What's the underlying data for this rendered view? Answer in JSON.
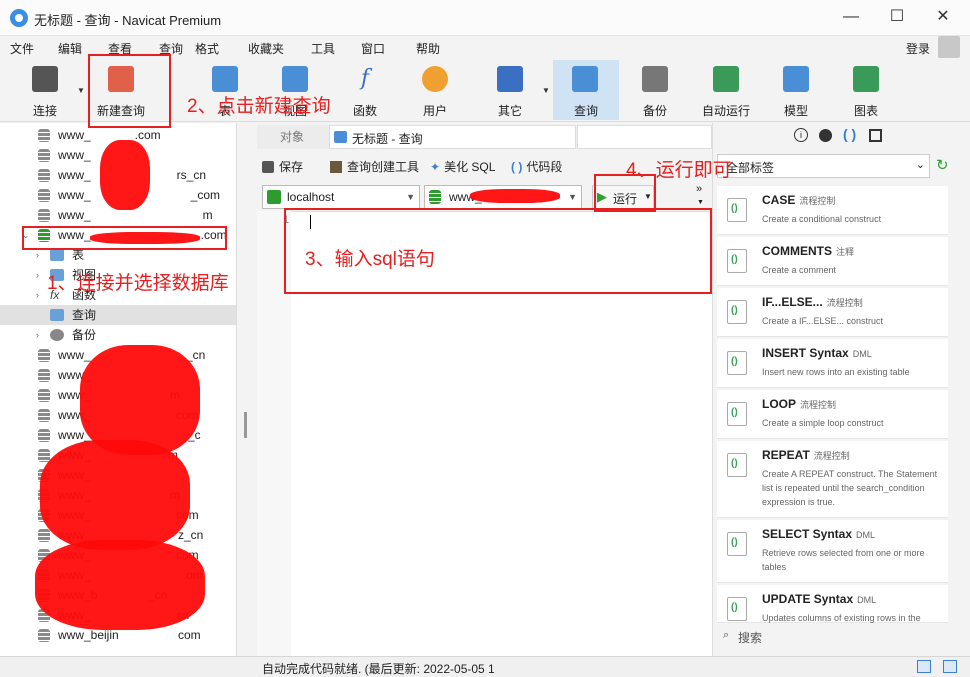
{
  "window": {
    "title": "无标题 - 查询 - Navicat Premium",
    "minimize": "—",
    "maximize": "☐",
    "close": "✕"
  },
  "menu": [
    "文件",
    "编辑",
    "查看",
    "查询",
    "格式",
    "收藏夹",
    "工具",
    "窗口",
    "帮助"
  ],
  "login": "登录",
  "toolbar": [
    {
      "label": "连接",
      "icon": "plug-icon",
      "color": "#555555"
    },
    {
      "label": "新建查询",
      "icon": "new-query-icon",
      "color": "#e0604a"
    },
    {
      "label": "表",
      "icon": "table-icon",
      "color": "#4a8fd6"
    },
    {
      "label": "视图",
      "icon": "view-icon",
      "color": "#4a8fd6"
    },
    {
      "label": "函数",
      "icon": "function-icon",
      "color": "#3a6fc2"
    },
    {
      "label": "用户",
      "icon": "user-icon",
      "color": "#f0a030"
    },
    {
      "label": "其它",
      "icon": "tools-icon",
      "color": "#3a6fc2"
    },
    {
      "label": "查询",
      "icon": "query-icon",
      "color": "#4a8fd6"
    },
    {
      "label": "备份",
      "icon": "backup-icon",
      "color": "#777777"
    },
    {
      "label": "自动运行",
      "icon": "auto-run-icon",
      "color": "#3a9a5a"
    },
    {
      "label": "模型",
      "icon": "model-icon",
      "color": "#4a8fd6"
    },
    {
      "label": "图表",
      "icon": "chart-icon",
      "color": "#3a9a5a"
    }
  ],
  "tree": {
    "rows": [
      {
        "label": "www_",
        "suffix": ".com"
      },
      {
        "label": "www_",
        "suffix": ""
      },
      {
        "label": "www_",
        "suffix": "rs_cn"
      },
      {
        "label": "www_",
        "suffix": "_com"
      },
      {
        "label": "www_",
        "suffix": "m"
      },
      {
        "label": "www_",
        "suffix": ".com"
      }
    ],
    "children": [
      "表",
      "视图",
      "函数",
      "查询",
      "备份"
    ],
    "more_rows": [
      {
        "label": "www_",
        "suffix": "_cn"
      },
      {
        "label": "www_",
        "suffix": ""
      },
      {
        "label": "www_",
        "suffix": "m"
      },
      {
        "label": "www_",
        "suffix": "com"
      },
      {
        "label": "www_",
        "suffix": "_c"
      },
      {
        "label": "www_",
        "suffix": "m"
      },
      {
        "label": "www_",
        "suffix": ""
      },
      {
        "label": "www_",
        "suffix": "m"
      },
      {
        "label": "www_",
        "suffix": "com"
      },
      {
        "label": "www_",
        "suffix": "z_cn"
      },
      {
        "label": "www_",
        "suffix": "com"
      },
      {
        "label": "www_",
        "suffix": "om"
      },
      {
        "label": "www_b",
        "suffix": "_cn"
      },
      {
        "label": "www_",
        "suffix": "_cn"
      },
      {
        "label": "www_beijin",
        "suffix": "com"
      }
    ]
  },
  "tabs": {
    "objects": "对象",
    "current": "无标题 - 查询"
  },
  "query_toolbar": {
    "save": "保存",
    "builder": "查询创建工具",
    "beautify": "美化 SQL",
    "snippet": "代码段"
  },
  "connection": "localhost",
  "database": "www_",
  "run_button": "运行",
  "editor": {
    "line_number": "1"
  },
  "right_panel": {
    "filter": "全部标签",
    "search_placeholder": "搜索",
    "snippets": [
      {
        "title": "CASE",
        "tag": "流程控制",
        "desc": "Create a conditional construct"
      },
      {
        "title": "COMMENTS",
        "tag": "注释",
        "desc": "Create a comment"
      },
      {
        "title": "IF...ELSE...",
        "tag": "流程控制",
        "desc": "Create a IF...ELSE... construct"
      },
      {
        "title": "INSERT Syntax",
        "tag": "DML",
        "desc": "Insert new rows into an existing table"
      },
      {
        "title": "LOOP",
        "tag": "流程控制",
        "desc": "Create a simple loop construct"
      },
      {
        "title": "REPEAT",
        "tag": "流程控制",
        "desc": "Create A REPEAT construct. The Statement list is repeated until the search_condition expression is true."
      },
      {
        "title": "SELECT Syntax",
        "tag": "DML",
        "desc": "Retrieve rows selected from one or more tables"
      },
      {
        "title": "UPDATE Syntax",
        "tag": "DML",
        "desc": "Updates columns of existing rows in the"
      }
    ]
  },
  "status": "自动完成代码就绪. (最后更新: 2022-05-05 1",
  "annotations": {
    "step1": "1、连接并选择数据库",
    "step2": "2、点击新建查询",
    "step3": "3、输入sql语句",
    "step4": "4、运行即可"
  }
}
